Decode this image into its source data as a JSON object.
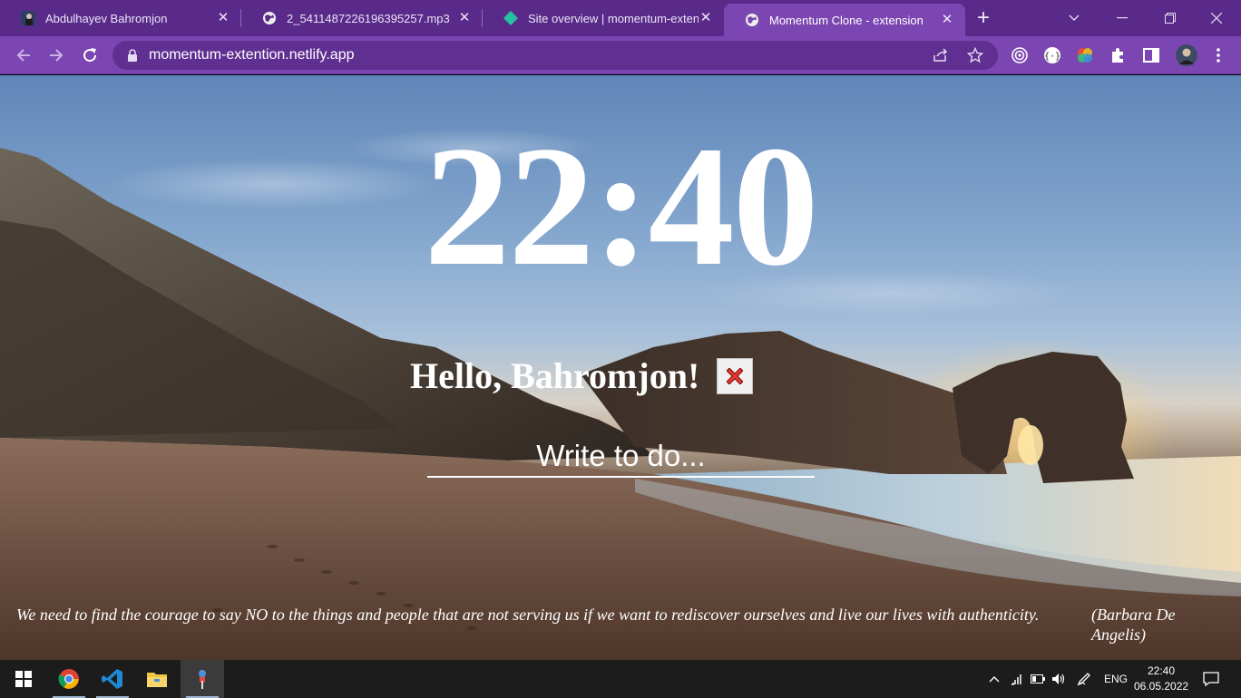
{
  "browser": {
    "tabs": [
      {
        "title": "Abdulhayev Bahromjon",
        "icon": "profile-photo-icon",
        "active": false
      },
      {
        "title": "2_5411487226196395257.mp3",
        "icon": "globe-icon",
        "active": false
      },
      {
        "title": "Site overview | momentum-extenti",
        "icon": "netlify-diamond-icon",
        "active": false
      },
      {
        "title": "Momentum Clone - extension",
        "icon": "globe-icon",
        "active": true
      }
    ],
    "new_tab_label": "+",
    "address": "momentum-extention.netlify.app",
    "colors": {
      "frame": "#5a2a8a",
      "toolbar": "#7b46b1",
      "omnibox": "#5f2f91"
    }
  },
  "app": {
    "time": "22:40",
    "greeting": "Hello, Bahromjon!",
    "todo_placeholder": "Write to do...",
    "quote": "We need to find the courage to say NO to the things and people that are not serving us if we want to rediscover ourselves and live our lives with authenticity.",
    "author": "(Barbara De Angelis)"
  },
  "taskbar": {
    "apps": [
      "windows-start-icon",
      "chrome-icon",
      "vscode-icon",
      "file-explorer-icon",
      "app-pin-icon"
    ],
    "language": "ENG",
    "time": "22:40",
    "date": "06.05.2022"
  }
}
